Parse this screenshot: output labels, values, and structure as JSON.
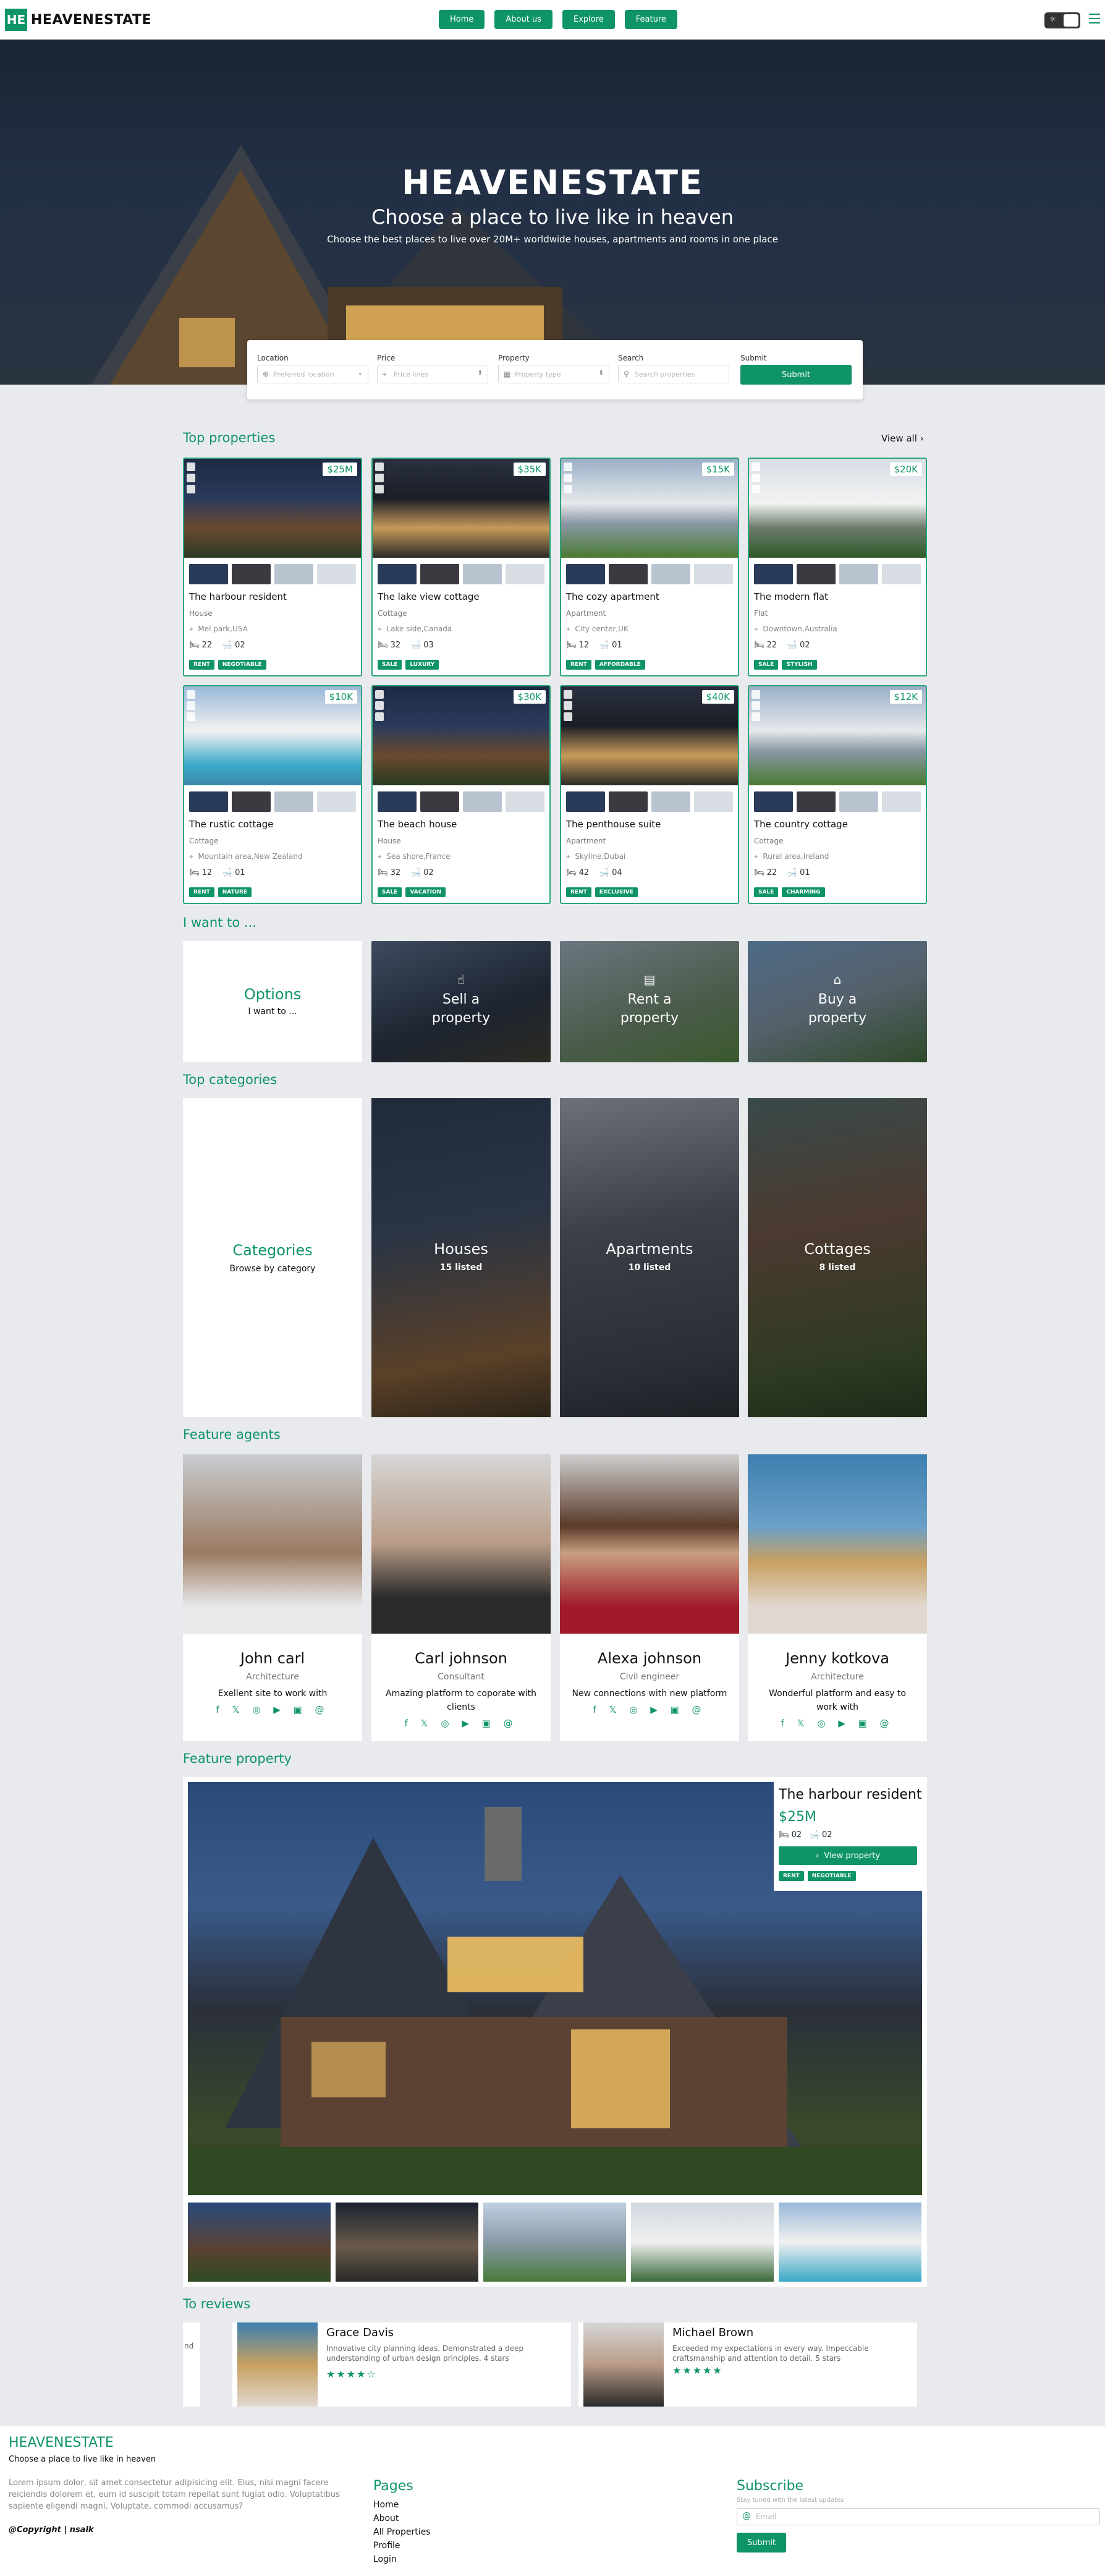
{
  "brand": {
    "logo": "HE",
    "name": "HEAVENESTATE"
  },
  "nav": {
    "items": [
      "Home",
      "About us",
      "Explore",
      "Feature"
    ],
    "toggle_icon": "sun-icon",
    "menu_icon": "hamburger-icon"
  },
  "hero": {
    "title": "HEAVENESTATE",
    "subtitle": "Choose a place to live like in heaven",
    "tagline": "Choose the best places to live over 20M+ worldwide houses, apartments and rooms in one place"
  },
  "search": {
    "location": {
      "label": "Location",
      "placeholder": "Preferred location"
    },
    "price": {
      "label": "Price",
      "placeholder": "Price lines"
    },
    "property": {
      "label": "Property",
      "placeholder": "Property type"
    },
    "search": {
      "label": "Search",
      "placeholder": "Search properties"
    },
    "submit": {
      "label": "Submit",
      "button": "Submit"
    }
  },
  "top_properties": {
    "title": "Top properties",
    "view_all": "View all",
    "items": [
      {
        "name": "The harbour resident",
        "price": "$25M",
        "type": "House",
        "location": "Mel park,USA",
        "beds": "22",
        "baths": "02",
        "tags": [
          "RENT",
          "NEGOTIABLE"
        ]
      },
      {
        "name": "The lake view cottage",
        "price": "$35K",
        "type": "Cottage",
        "location": "Lake side,Canada",
        "beds": "32",
        "baths": "03",
        "tags": [
          "SALE",
          "LUXURY"
        ]
      },
      {
        "name": "The cozy apartment",
        "price": "$15K",
        "type": "Apartment",
        "location": "City center,UK",
        "beds": "12",
        "baths": "01",
        "tags": [
          "RENT",
          "AFFORDABLE"
        ]
      },
      {
        "name": "The modern flat",
        "price": "$20K",
        "type": "Flat",
        "location": "Downtown,Australia",
        "beds": "22",
        "baths": "02",
        "tags": [
          "SALE",
          "STYLISH"
        ]
      },
      {
        "name": "The rustic cottage",
        "price": "$10K",
        "type": "Cottage",
        "location": "Mountain area,New Zealand",
        "beds": "12",
        "baths": "01",
        "tags": [
          "RENT",
          "NATURE"
        ]
      },
      {
        "name": "The beach house",
        "price": "$30K",
        "type": "House",
        "location": "Sea shore,France",
        "beds": "32",
        "baths": "02",
        "tags": [
          "SALE",
          "VACATION"
        ]
      },
      {
        "name": "The penthouse suite",
        "price": "$40K",
        "type": "Apartment",
        "location": "Skyline,Dubai",
        "beds": "42",
        "baths": "04",
        "tags": [
          "RENT",
          "EXCLUSIVE"
        ]
      },
      {
        "name": "The country cottage",
        "price": "$12K",
        "type": "Cottage",
        "location": "Rural area,Ireland",
        "beds": "22",
        "baths": "01",
        "tags": [
          "SALE",
          "CHARMING"
        ]
      }
    ]
  },
  "want": {
    "title": "I want to ...",
    "options_title": "Options",
    "options_sub": "I want to ...",
    "items": [
      {
        "label": "Sell a property",
        "icon": "hand-icon"
      },
      {
        "label": "Rent a property",
        "icon": "calendar-icon"
      },
      {
        "label": "Buy a property",
        "icon": "home-icon"
      }
    ]
  },
  "categories": {
    "title": "Top categories",
    "card_title": "Categories",
    "card_sub": "Browse by category",
    "items": [
      {
        "label": "Houses",
        "count": "15 listed"
      },
      {
        "label": "Apartments",
        "count": "10 listed"
      },
      {
        "label": "Cottages",
        "count": "8 listed"
      }
    ]
  },
  "agents": {
    "title": "Feature agents",
    "items": [
      {
        "name": "John carl",
        "role": "Architecture",
        "desc": "Exellent site to work with"
      },
      {
        "name": "Carl johnson",
        "role": "Consultant",
        "desc": "Amazing platform to coporate with clients"
      },
      {
        "name": "Alexa johnson",
        "role": "Civil engineer",
        "desc": "New connections with new platform"
      },
      {
        "name": "Jenny kotkova",
        "role": "Architecture",
        "desc": "Wonderful platform and easy to work with"
      }
    ],
    "social_icons": "f 𝕏 ◎ ▶ ▣ @"
  },
  "feature_property": {
    "title": "Feature property",
    "name": "The harbour resident",
    "price": "$25M",
    "beds": "02",
    "baths": "02",
    "button": "View property",
    "tags": [
      "RENT",
      "NEGOTIABLE"
    ]
  },
  "reviews": {
    "title": "To reviews",
    "partial_text": "nd",
    "items": [
      {
        "name": "Grace Davis",
        "text": "Innovative city planning ideas. Demonstrated a deep understanding of urban design principles. 4 stars",
        "stars": "★★★★☆"
      },
      {
        "name": "Michael Brown",
        "text": "Exceeded my expectations in every way. Impeccable craftsmanship and attention to detail. 5 stars",
        "stars": "★★★★★"
      }
    ]
  },
  "footer": {
    "brand": "HEAVENESTATE",
    "tagline": "Choose a place to live like in heaven",
    "lorem": "Lorem ipsum dolor, sit amet consectetur adipisicing elit. Eius, nisi magni facere reiciendis dolorem et, eum id suscipit totam repellat sunt fugiat odio. Voluptatibus sapiente eligendi magni. Voluptate, commodi accusamus?",
    "copyright": "@Copyright | nsalk",
    "pages_title": "Pages",
    "pages": [
      "Home",
      "About",
      "All Properties",
      "Profile",
      "Login"
    ],
    "subscribe_title": "Subscribe",
    "subscribe_sub": "Stay tuned with the latest updates",
    "email_placeholder": "Email",
    "submit": "Submit"
  },
  "colors": {
    "accent": "#0e9468",
    "background": "#e8eaed"
  }
}
